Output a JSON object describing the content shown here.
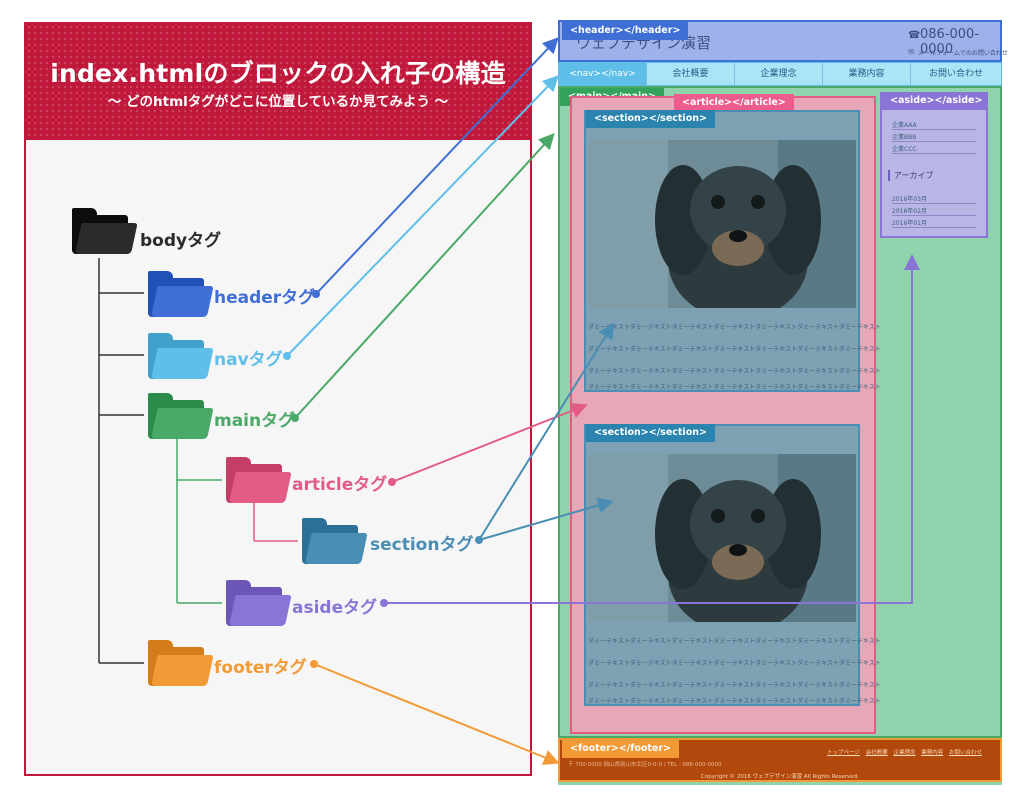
{
  "title": "index.htmlのブロックの入れ子の構造",
  "subtitle": "～ どのhtmlタグがどこに位置しているか見てみよう ～",
  "tree": {
    "body": {
      "label": "bodyタグ",
      "color": "#2b2b2b",
      "icon": "folder-icon"
    },
    "header": {
      "label": "headerタグ",
      "color": "#3f6fd4",
      "icon": "folder-icon"
    },
    "nav": {
      "label": "navタグ",
      "color": "#5fbfe9",
      "icon": "folder-icon"
    },
    "main": {
      "label": "mainタグ",
      "color": "#4aa868",
      "icon": "folder-icon"
    },
    "article": {
      "label": "articleタグ",
      "color": "#e25c86",
      "icon": "folder-icon"
    },
    "section": {
      "label": "sectionタグ",
      "color": "#4a8eb5",
      "icon": "folder-icon"
    },
    "aside": {
      "label": "asideタグ",
      "color": "#8a74d6",
      "icon": "folder-icon"
    },
    "footer": {
      "label": "footerタグ",
      "color": "#f29a35",
      "icon": "folder-icon"
    }
  },
  "mockup": {
    "site_title": "ウェブデザイン演習",
    "phone": "086-000-0000",
    "phone_icon": "phone-icon",
    "mail_link": "メールフォームでのお問い合わせ",
    "mail_icon": "mail-icon",
    "nav_items": [
      "<nav></nav>",
      "会社概要",
      "企業理念",
      "業務内容",
      "お問い合わせ"
    ],
    "tags": {
      "header": "<header></header>",
      "nav": "<nav></nav>",
      "main": "<main></main>",
      "article": "<article></article>",
      "section1": "<section></section>",
      "section2": "<section></section>",
      "aside": "<aside></aside>",
      "footer": "<footer></footer>"
    },
    "aside_links": [
      "企業AAA",
      "企業BBB",
      "企業CCC"
    ],
    "archive_title": "アーカイブ",
    "archive_links": [
      "2016年03月",
      "2016年02月",
      "2016年01月"
    ],
    "dummy_text": "ダミーテキストダミーテキストダミーテキストダミーテキストダミーテキストダミーテキストダミーテキスト",
    "footer_links": [
      "トップページ",
      "会社概要",
      "企業理念",
      "業務内容",
      "お問い合わせ"
    ],
    "footer_address": "〒 700-0000 岡山県岡山市北区0-0-0 / TEL : 086-000-0000",
    "copyright": "Copyright © 2016 ウェブデザイン演習 All Rights Reserved."
  },
  "colors": {
    "title_band": "#c0183a",
    "main_green": "#8fd4ad",
    "article_pink": "#e7a7b6",
    "section_blue": "#5f8ea8",
    "aside_purple": "#b9b6e6",
    "footer_orange": "#b2480b"
  }
}
